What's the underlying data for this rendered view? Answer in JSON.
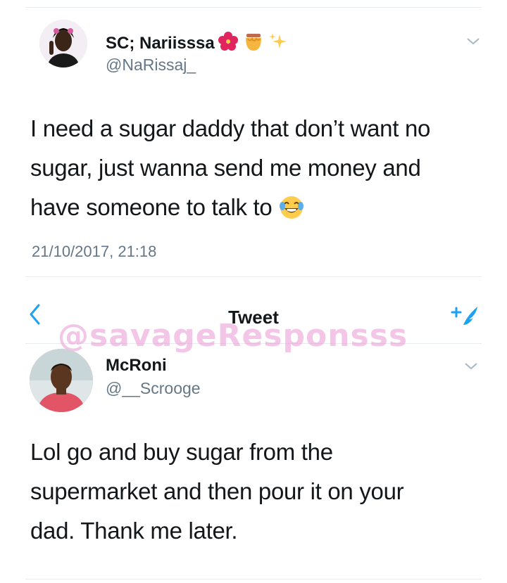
{
  "top_tweet": {
    "display_name": "SC; Nariisssa",
    "emojis": [
      "hibiscus",
      "honey-pot",
      "sparkles"
    ],
    "handle": "@NaRissaj_",
    "text_lines": [
      "I need a sugar daddy that don’t want no",
      "sugar, just wanna send me money and",
      "have someone to talk to"
    ],
    "emoji_end": "tears-of-joy",
    "timestamp": "21/10/2017, 21:18"
  },
  "nav": {
    "title": "Tweet"
  },
  "watermark": "@savageResponsss",
  "reply_tweet": {
    "display_name": "McRoni",
    "handle": "@__Scrooge",
    "text_lines": [
      "Lol go and buy sugar from the",
      "supermarket and then pour it on your",
      "dad. Thank me later."
    ]
  },
  "colors": {
    "accent": "#1da1f2",
    "secondary_text": "#657786",
    "divider": "#e6ecf0"
  }
}
